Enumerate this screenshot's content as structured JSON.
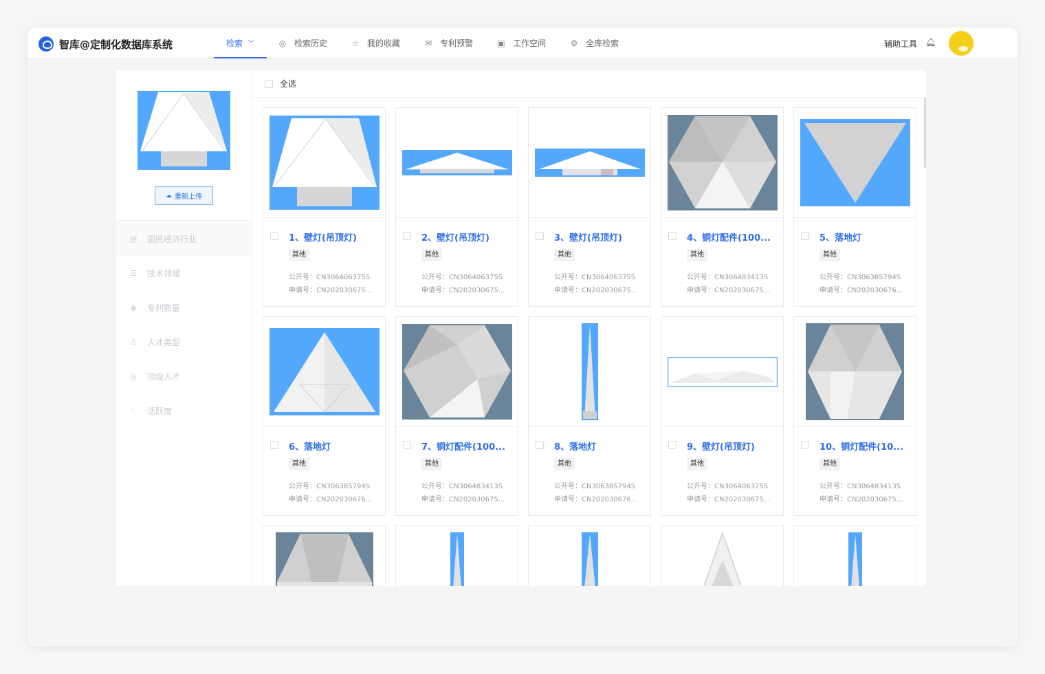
{
  "app": {
    "title": "智库@定制化数据库系统"
  },
  "nav": [
    {
      "label": "检索",
      "icon": "chevron-down-icon",
      "active": true
    },
    {
      "label": "检索历史",
      "icon": "history-search-icon"
    },
    {
      "label": "我的收藏",
      "icon": "star-icon"
    },
    {
      "label": "专利预警",
      "icon": "mail-alert-icon"
    },
    {
      "label": "工作空间",
      "icon": "briefcase-icon"
    },
    {
      "label": "全库检索",
      "icon": "gear-search-icon"
    }
  ],
  "header": {
    "aux_tools": "辅助工具",
    "bell_icon": "bell-icon"
  },
  "sidebar": {
    "reupload_label": "重新上传",
    "menu": [
      {
        "label": "国民经济行业",
        "icon": "doc-icon"
      },
      {
        "label": "技术领域",
        "icon": "list-icon"
      },
      {
        "label": "专利数量",
        "icon": "location-icon"
      },
      {
        "label": "人才类型",
        "icon": "people-icon"
      },
      {
        "label": "顶级人才",
        "icon": "user-circle-icon"
      },
      {
        "label": "活跃度",
        "icon": "activity-icon"
      }
    ]
  },
  "results": {
    "select_all": "全选",
    "pub_label": "公开号：",
    "app_label": "申请号：",
    "items": [
      {
        "title": "1、壁灯(吊顶灯)",
        "tag": "其他",
        "pub": "CN306406375S",
        "app": "CN202030675..."
      },
      {
        "title": "2、壁灯(吊顶灯)",
        "tag": "其他",
        "pub": "CN306406375S",
        "app": "CN202030675..."
      },
      {
        "title": "3、壁灯(吊顶灯)",
        "tag": "其他",
        "pub": "CN306406375S",
        "app": "CN202030675..."
      },
      {
        "title": "4、铜灯配件(100...",
        "tag": "其他",
        "pub": "CN306483413S",
        "app": "CN202030675..."
      },
      {
        "title": "5、落地灯",
        "tag": "其他",
        "pub": "CN306385794S",
        "app": "CN202030676..."
      },
      {
        "title": "6、落地灯",
        "tag": "其他",
        "pub": "CN306385794S",
        "app": "CN202030676..."
      },
      {
        "title": "7、铜灯配件(100...",
        "tag": "其他",
        "pub": "CN306483413S",
        "app": "CN202030675..."
      },
      {
        "title": "8、落地灯",
        "tag": "其他",
        "pub": "CN306385794S",
        "app": "CN202030676..."
      },
      {
        "title": "9、壁灯(吊顶灯)",
        "tag": "其他",
        "pub": "CN306406375S",
        "app": "CN202030675..."
      },
      {
        "title": "10、铜灯配件(10...",
        "tag": "其他",
        "pub": "CN306483413S",
        "app": "CN202030675..."
      }
    ]
  },
  "colors": {
    "accent": "#2e6ee6",
    "thumb_blue": "#53a8fe",
    "thumb_slate": "#6a8499"
  }
}
